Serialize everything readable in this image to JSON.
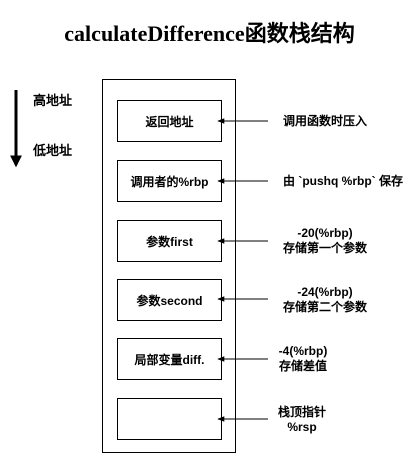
{
  "title": "calculateDifference函数栈结构",
  "address": {
    "high": "高地址",
    "low": "低地址"
  },
  "cells": [
    {
      "label": "返回地址",
      "note": [
        "调用函数时压入"
      ]
    },
    {
      "label": "调用者的%rbp",
      "note": [
        "由 `pushq %rbp` 保存"
      ]
    },
    {
      "label": "参数first",
      "note": [
        "-20(%rbp)",
        "存储第一个参数"
      ]
    },
    {
      "label": "参数second",
      "note": [
        "-24(%rbp)",
        "存储第二个参数"
      ]
    },
    {
      "label": "局部变量diff.",
      "note": [
        "-4(%rbp)",
        "存储差值"
      ]
    },
    {
      "label": "",
      "note": [
        "栈顶指针",
        "%rsp"
      ]
    }
  ]
}
